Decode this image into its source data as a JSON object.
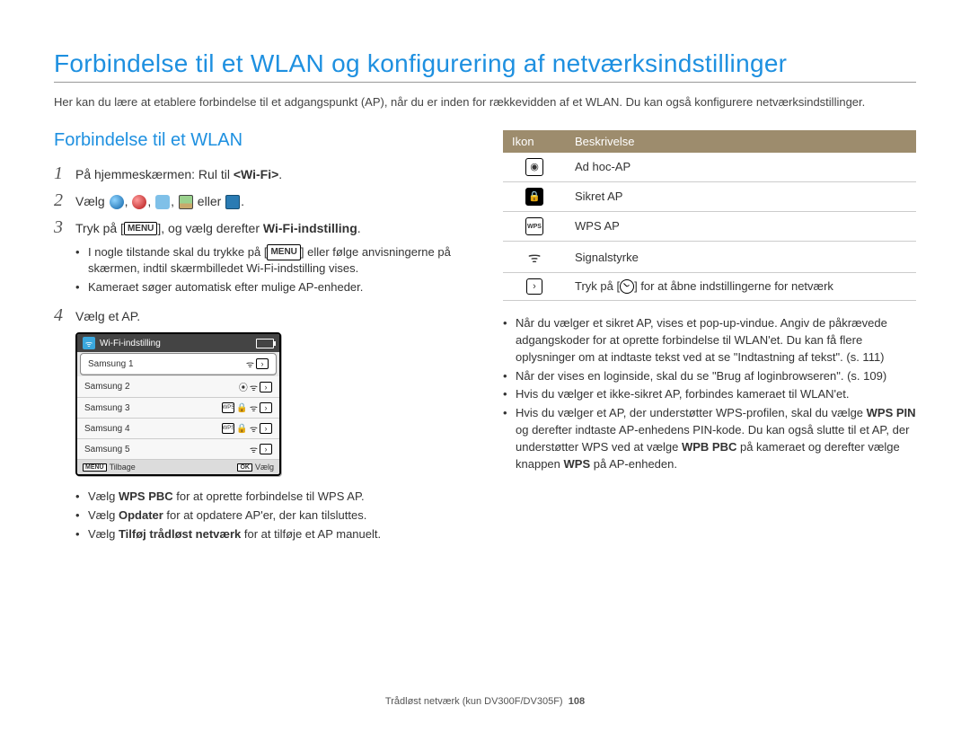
{
  "title": "Forbindelse til et WLAN og konfigurering af netværksindstillinger",
  "intro": "Her kan du lære at etablere forbindelse til et adgangspunkt (AP), når du er inden for rækkevidden af et WLAN. Du kan også konfigurere netværksindstillinger.",
  "section_heading": "Forbindelse til et WLAN",
  "steps": {
    "s1_pre": "På hjemmeskærmen: Rul til ",
    "s1_bold": "<Wi-Fi>",
    "s1_post": ".",
    "s2_pre": "Vælg ",
    "s2_mid": ", ",
    "s2_or": " eller ",
    "s2_post": ".",
    "s3_pre": "Tryk på [",
    "s3_menu": "MENU",
    "s3_mid": "], og vælg derefter ",
    "s3_bold": "Wi-Fi-indstilling",
    "s3_post": ".",
    "s4": "Vælg et AP."
  },
  "step3_bullets": [
    "I nogle tilstande skal du trykke på [MENU] eller følge anvisningerne på skærmen, indtil skærmbilledet Wi-Fi-indstilling vises.",
    "Kameraet søger automatisk efter mulige AP-enheder."
  ],
  "screenshot": {
    "title": "Wi-Fi-indstilling",
    "rows": [
      "Samsung 1",
      "Samsung 2",
      "Samsung 3",
      "Samsung 4",
      "Samsung 5"
    ],
    "back_key": "MENU",
    "back_label": "Tilbage",
    "select_key": "OK",
    "select_label": "Vælg"
  },
  "after_screenshot_bullets": [
    {
      "pre": "Vælg ",
      "bold": "WPS PBC",
      "post": " for at oprette forbindelse til WPS AP."
    },
    {
      "pre": "Vælg ",
      "bold": "Opdater",
      "post": " for at opdatere AP'er, der kan tilsluttes."
    },
    {
      "pre": "Vælg ",
      "bold": "Tilføj trådløst netværk",
      "post": " for at tilføje et AP manuelt."
    }
  ],
  "table": {
    "head_icon": "Ikon",
    "head_desc": "Beskrivelse",
    "rows": [
      {
        "desc": "Ad hoc-AP"
      },
      {
        "desc": "Sikret AP"
      },
      {
        "desc": "WPS AP"
      },
      {
        "desc": "Signalstyrke"
      },
      {
        "desc_pre": "Tryk på [",
        "desc_post": "] for at åbne indstillingerne for netværk"
      }
    ]
  },
  "right_bullets": [
    "Når du vælger et sikret AP, vises et pop-up-vindue. Angiv de påkrævede adgangskoder for at oprette forbindelse til WLAN'et. Du kan få flere oplysninger om at indtaste tekst ved at se \"Indtastning af tekst\". (s. 111)",
    "Når der vises en loginside, skal du se \"Brug af loginbrowseren\". (s. 109)",
    "Hvis du vælger et ikke-sikret AP, forbindes kameraet til WLAN'et."
  ],
  "right_bullet4": {
    "pre": "Hvis du vælger et AP, der understøtter WPS-profilen, skal du vælge ",
    "b1": "WPS PIN",
    "mid1": " og derefter indtaste AP-enhedens PIN-kode. Du kan også slutte til et AP, der understøtter WPS ved at vælge ",
    "b2": "WPB PBC",
    "mid2": " på kameraet og derefter vælge knappen ",
    "b3": "WPS",
    "post": " på AP-enheden."
  },
  "footer_text": "Trådløst netværk (kun DV300F/DV305F)",
  "footer_page": "108"
}
